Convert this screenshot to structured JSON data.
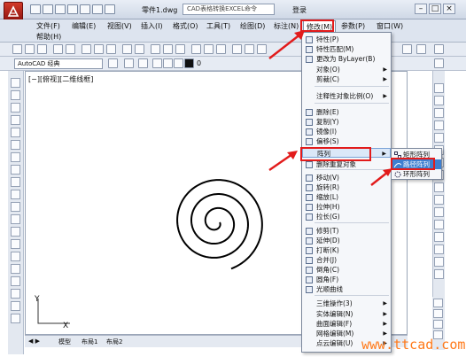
{
  "titlebar": {
    "file_name": "零件1.dwg",
    "search_placeholder": "CAD表格转换EXCEL命令",
    "login": "登录",
    "minimize": "–",
    "restore": "□",
    "close": "×"
  },
  "menubar": {
    "items": [
      "文件(F)",
      "编辑(E)",
      "视图(V)",
      "插入(I)",
      "格式(O)",
      "工具(T)",
      "绘图(D)",
      "标注(N)",
      "修改(M)",
      "参数(P)",
      "窗口(W)"
    ],
    "help": "帮助(H)",
    "active_index": 8
  },
  "toolbar": {
    "workspace": "AutoCAD 经典",
    "layer_value": "0"
  },
  "canvas": {
    "viewport_label": "[−][俯视][二维线框]",
    "ucs_x": "X",
    "ucs_y": "Y"
  },
  "layout_tabs": [
    "模型",
    "布局1",
    "布局2"
  ],
  "modify_menu": {
    "items": [
      {
        "label": "特性(P)",
        "icon": "properties-icon"
      },
      {
        "label": "特性匹配(M)",
        "icon": "match-properties-icon"
      },
      {
        "label": "更改为 ByLayer(B)",
        "icon": "bylayer-icon"
      },
      {
        "label": "对象(O)",
        "icon": "",
        "submenu": true
      },
      {
        "label": "剪裁(C)",
        "icon": "",
        "submenu": true
      },
      {
        "label": "注释性对象比例(O)",
        "icon": "",
        "submenu": true
      },
      {
        "label": "删除(E)",
        "icon": "erase-icon"
      },
      {
        "label": "复制(Y)",
        "icon": "copy-icon"
      },
      {
        "label": "镜像(I)",
        "icon": "mirror-icon"
      },
      {
        "label": "偏移(S)",
        "icon": "offset-icon"
      },
      {
        "label": "阵列",
        "icon": "",
        "submenu": true
      },
      {
        "label": "删除重复对象",
        "icon": "overkill-icon"
      },
      {
        "label": "移动(V)",
        "icon": "move-icon"
      },
      {
        "label": "旋转(R)",
        "icon": "rotate-icon"
      },
      {
        "label": "缩放(L)",
        "icon": "scale-icon"
      },
      {
        "label": "拉伸(H)",
        "icon": "stretch-icon"
      },
      {
        "label": "拉长(G)",
        "icon": "lengthen-icon"
      },
      {
        "label": "修剪(T)",
        "icon": "trim-icon"
      },
      {
        "label": "延伸(D)",
        "icon": "extend-icon"
      },
      {
        "label": "打断(K)",
        "icon": "break-icon"
      },
      {
        "label": "合并(J)",
        "icon": "join-icon"
      },
      {
        "label": "倒角(C)",
        "icon": "chamfer-icon"
      },
      {
        "label": "圆角(F)",
        "icon": "fillet-icon"
      },
      {
        "label": "光顺曲线",
        "icon": "blend-icon"
      },
      {
        "label": "三维操作(3)",
        "icon": "",
        "submenu": true
      },
      {
        "label": "实体编辑(N)",
        "icon": "",
        "submenu": true
      },
      {
        "label": "曲面编辑(F)",
        "icon": "",
        "submenu": true
      },
      {
        "label": "网格编辑(M)",
        "icon": "",
        "submenu": true
      },
      {
        "label": "点云编辑(U)",
        "icon": "",
        "submenu": true
      }
    ],
    "highlighted": "阵列"
  },
  "array_submenu": {
    "items": [
      "矩形阵列",
      "路径阵列",
      "环形阵列"
    ],
    "highlighted": "路径阵列"
  },
  "watermark": "www.ttcad.com",
  "colors": {
    "highlight_box": "#e21b1b",
    "submenu_select": "#3e7fd0",
    "watermark": "#ff7a1a"
  }
}
